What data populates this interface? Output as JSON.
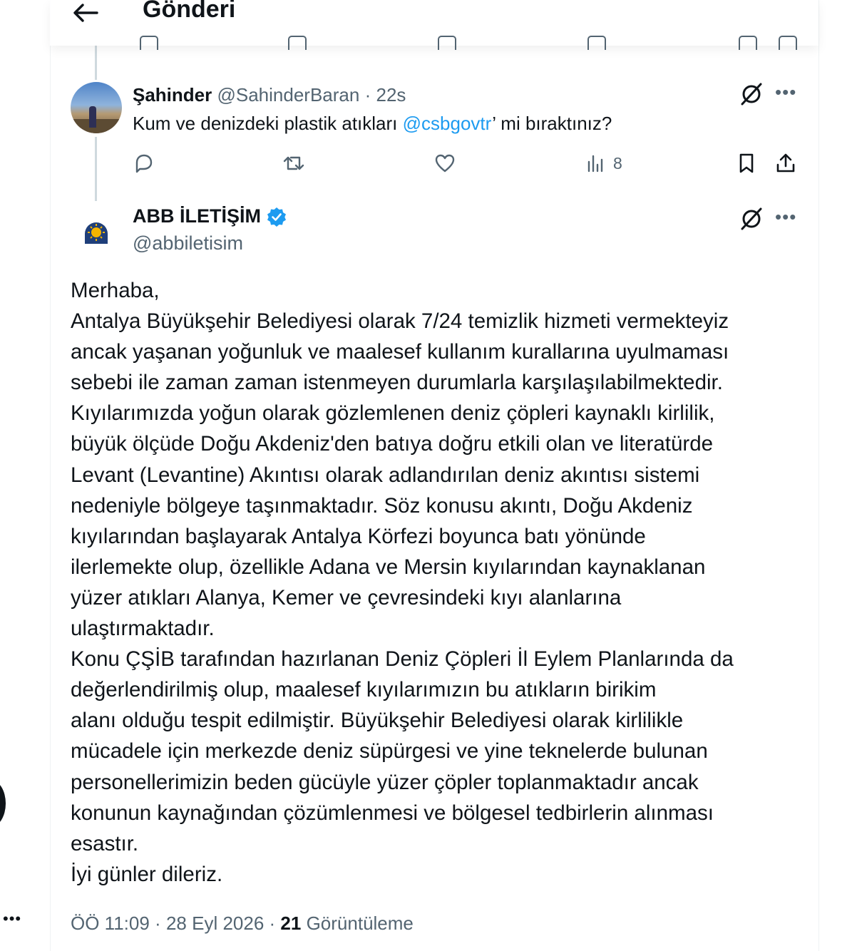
{
  "header": {
    "title": "Gönderi"
  },
  "reply_tweet": {
    "author_name": "Şahinder",
    "author_handle": "@SahinderBaran",
    "time": "22s",
    "text_before": "Kum ve denizdeki plastik atıkları ",
    "mention": "@csbgovtr",
    "text_after": "’ mi bıraktınız?",
    "views_count": "8"
  },
  "main_tweet": {
    "author_name": "ABB İLETİŞİM",
    "author_handle": "@abbiletisim",
    "verified": true,
    "lines": [
      "Merhaba,",
      "Antalya Büyükşehir Belediyesi olarak 7/24 temizlik hizmeti vermekteyiz",
      "ancak yaşanan yoğunluk ve maalesef kullanım kurallarına uyulmaması",
      "sebebi ile zaman zaman istenmeyen durumlarla karşılaşılabilmektedir.",
      "Kıyılarımızda yoğun olarak gözlemlenen deniz çöpleri kaynaklı kirlilik,",
      "büyük ölçüde Doğu Akdeniz'den batıya doğru etkili olan ve literatürde",
      "Levant (Levantine) Akıntısı olarak adlandırılan deniz akıntısı sistemi",
      "nedeniyle bölgeye taşınmaktadır. Söz konusu akıntı, Doğu Akdeniz",
      "kıyılarından başlayarak Antalya Körfezi boyunca batı yönünde",
      "ilerlemekte olup, özellikle Adana ve Mersin kıyılarından kaynaklanan",
      "yüzer atıkları Alanya, Kemer ve çevresindeki kıyı alanlarına",
      "ulaştırmaktadır.",
      "Konu ÇŞİB tarafından hazırlanan Deniz Çöpleri İl Eylem Planlarında da",
      "değerlendirilmiş olup, maalesef kıyılarımızın bu atıkların birikim",
      "alanı olduğu tespit edilmiştir. Büyükşehir Belediyesi olarak kirlilikle",
      "mücadele için merkezde deniz süpürgesi ve yine teknelerde bulunan",
      "personellerimizin beden gücüyle yüzer çöpler toplanmaktadır ancak",
      "konunun kaynağından çözümlenmesi ve bölgesel tedbirlerin alınması",
      "esastır.",
      "İyi günler dileriz."
    ],
    "meta_time": "ÖÖ 11:09",
    "meta_date": "28 Eyl 2026",
    "views_count": "21",
    "views_label": "Görüntüleme"
  },
  "icons": {
    "back": "arrow-left-icon",
    "grok": "grok-icon",
    "more": "more-icon",
    "reply": "reply-icon",
    "retweet": "retweet-icon",
    "like": "heart-icon",
    "views": "views-icon",
    "bookmark": "bookmark-icon",
    "share": "share-icon",
    "verified": "verified-badge-icon"
  },
  "colors": {
    "text": "#0f1419",
    "muted": "#536471",
    "link": "#1d9bf0",
    "verified": "#1d9bf0",
    "border": "#eff3f4"
  }
}
